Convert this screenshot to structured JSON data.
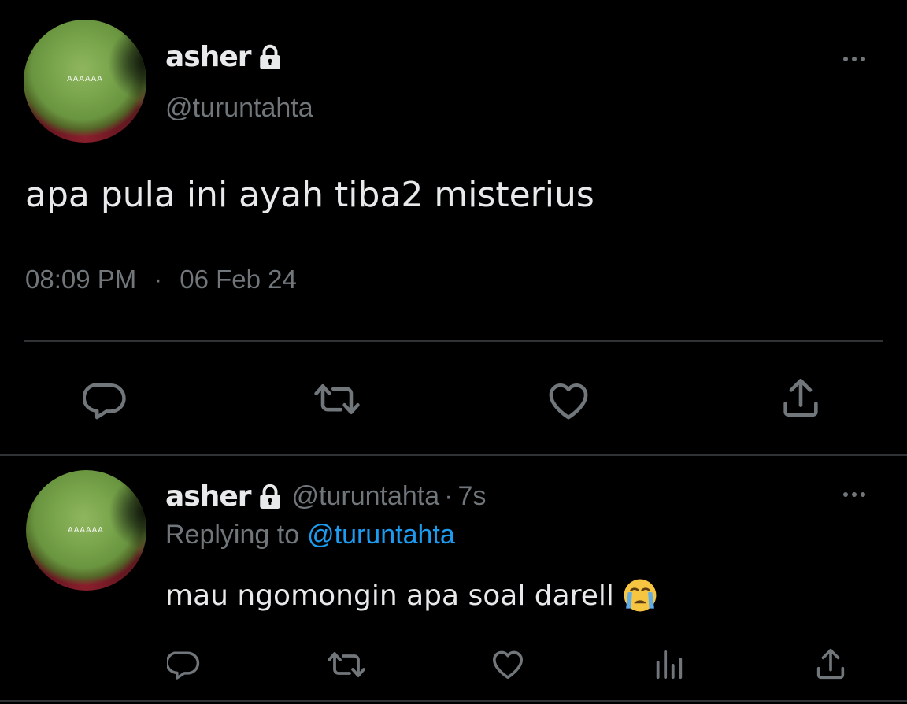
{
  "main_tweet": {
    "avatar_text": "AAAAAA",
    "display_name": "asher",
    "handle": "@turuntahta",
    "text": "apa pula ini ayah tiba2 misterius",
    "time": "08:09 PM",
    "separator": "·",
    "date": "06 Feb 24",
    "actions": [
      "reply-icon",
      "retweet-icon",
      "like-icon",
      "share-icon"
    ]
  },
  "reply_tweet": {
    "avatar_text": "AAAAAA",
    "display_name": "asher",
    "handle": "@turuntahta",
    "meta_sep": "·",
    "age": "7s",
    "replying_label": "Replying to",
    "replying_handle": "@turuntahta",
    "text": "mau ngomongin apa soal darell",
    "emoji": "😭",
    "actions": [
      "reply-icon",
      "retweet-icon",
      "like-icon",
      "views-icon",
      "share-icon"
    ]
  },
  "colors": {
    "background": "#000000",
    "primary_text": "#e7e9ea",
    "secondary_text": "#71767b",
    "accent": "#1d9bf0",
    "divider": "#2f3336"
  }
}
